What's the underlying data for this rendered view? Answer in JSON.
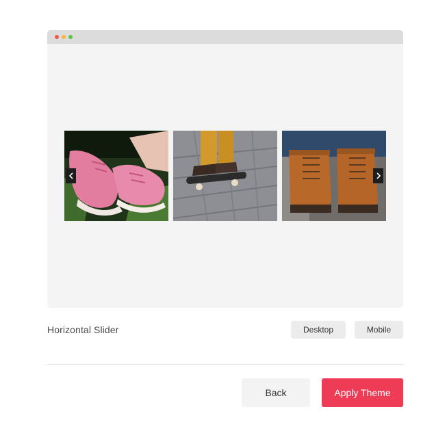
{
  "preview": {
    "window_dots": [
      "red",
      "yellow",
      "green"
    ],
    "slides": [
      {
        "image": "pink-sneakers-on-grass"
      },
      {
        "image": "skateboarder-feet-on-pavement"
      },
      {
        "image": "brown-work-boots"
      }
    ],
    "prev_icon": "chevron-left-icon",
    "next_icon": "chevron-right-icon"
  },
  "theme": {
    "name": "Horizontal Slider"
  },
  "view_toggle": {
    "desktop_label": "Desktop",
    "mobile_label": "Mobile"
  },
  "footer": {
    "back_label": "Back",
    "apply_label": "Apply Theme"
  },
  "colors": {
    "accent": "#ee3b56",
    "preview_bg": "#f4f4f4",
    "window_bar": "#dcdcdc"
  }
}
